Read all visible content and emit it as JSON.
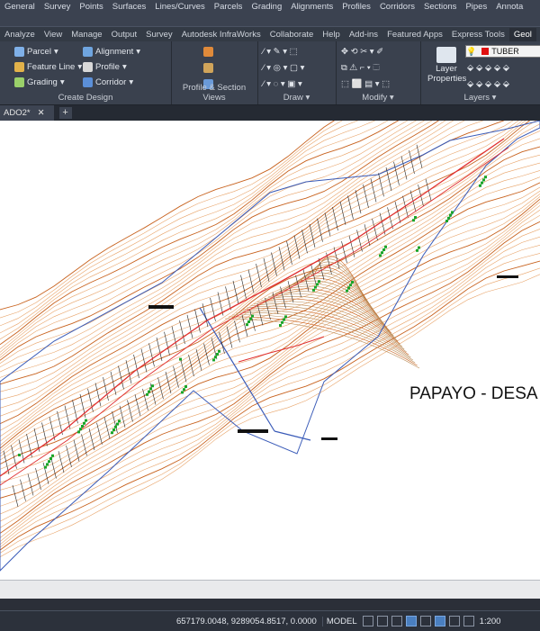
{
  "menubar": [
    "General",
    "Survey",
    "Points",
    "Surfaces",
    "Lines/Curves",
    "Parcels",
    "Grading",
    "Alignments",
    "Profiles",
    "Corridors",
    "Sections",
    "Pipes",
    "Annota"
  ],
  "tabs": [
    "Analyze",
    "View",
    "Manage",
    "Output",
    "Survey",
    "Autodesk InfraWorks",
    "Collaborate",
    "Help",
    "Add-ins",
    "Featured Apps",
    "Express Tools",
    "Geol"
  ],
  "active_tab": "Geol",
  "ribbon": {
    "create_design": {
      "title": "Create Design",
      "items": [
        "Parcel",
        "Feature Line",
        "Grading",
        "Alignment",
        "Profile",
        "Corridor"
      ]
    },
    "profile_section": {
      "title": "Profile & Section Views"
    },
    "draw": {
      "title": "Draw"
    },
    "modify": {
      "title": "Modify"
    },
    "layers": {
      "title": "Layers",
      "layer_properties": "Layer Properties",
      "current_layer": "TUBER"
    }
  },
  "document_tab": {
    "label": "ADO2*"
  },
  "drawing": {
    "title_text": "PAPAYO - DESA"
  },
  "statusbar": {
    "coordinates": "657179.0048, 9289054.8517, 0.0000",
    "space": "MODEL",
    "scale": "1:200"
  },
  "colors": {
    "contour_major": "#c8621e",
    "contour_minor": "#e8a368",
    "boundary": "#3a5bb8",
    "road": "#e03030",
    "lots": "#222222",
    "vegetation": "#1aa52a",
    "accent": "#4a7fc0"
  }
}
